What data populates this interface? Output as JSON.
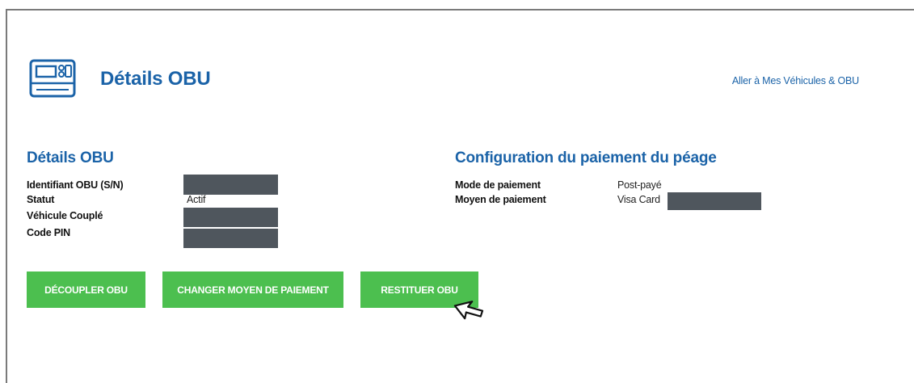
{
  "header": {
    "title": "Détails OBU",
    "goto_link": "Aller à Mes Véhicules & OBU",
    "icon": "obu-device-icon"
  },
  "details": {
    "title": "Détails OBU",
    "rows": [
      {
        "label": "Identifiant OBU (S/N)",
        "value": "",
        "redacted": true
      },
      {
        "label": "Statut",
        "value": "Actif",
        "redacted": false
      },
      {
        "label": "Véhicule Couplé",
        "value": "",
        "redacted": true
      },
      {
        "label": "Code PIN",
        "value": "",
        "redacted": true
      }
    ]
  },
  "payment": {
    "title": "Configuration du paiement du péage",
    "rows": [
      {
        "label": "Mode de paiement",
        "value": "Post-payé"
      },
      {
        "label": "Moyen de paiement",
        "value": "Visa Card",
        "redacted_suffix": true
      }
    ]
  },
  "actions": {
    "decouple": "DÉCOUPLER OBU",
    "change_payment": "CHANGER MOYEN DE PAIEMENT",
    "return_obu": "RESTITUER OBU"
  },
  "colors": {
    "title_blue": "#1b63a8",
    "button_green": "#4cbf4f",
    "redaction": "#4f565d"
  },
  "cursor": "arrow-cursor-icon"
}
